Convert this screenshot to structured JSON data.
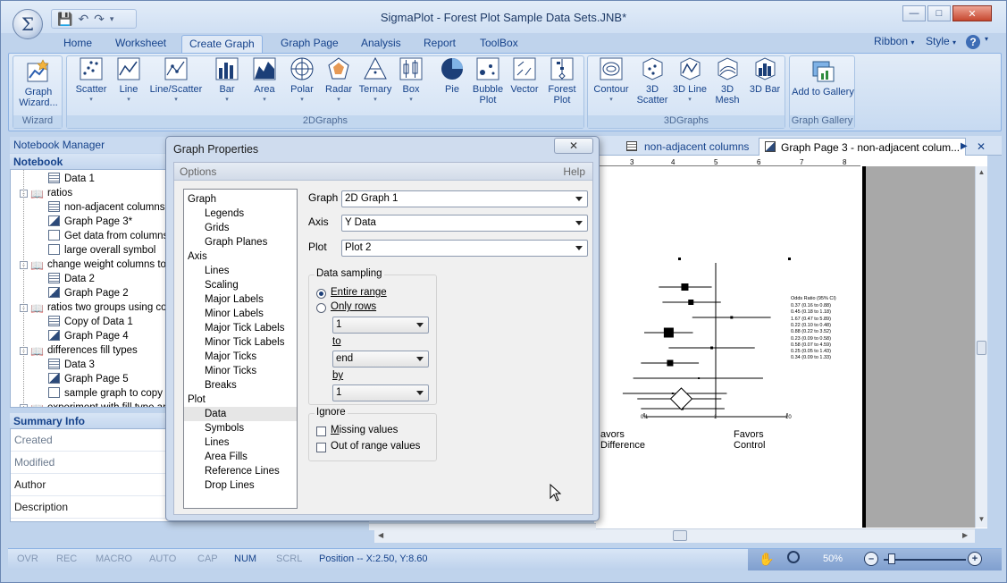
{
  "window": {
    "title": "SigmaPlot - Forest Plot Sample Data Sets.JNB*"
  },
  "quick_access": {
    "icons": [
      "save-icon",
      "undo-icon",
      "redo-icon",
      "customize-icon"
    ]
  },
  "ribbon_tabs": [
    "Home",
    "Worksheet",
    "Create Graph",
    "Graph Page",
    "Analysis",
    "Report",
    "ToolBox"
  ],
  "ribbon_active": "Create Graph",
  "ribbon_right": {
    "ribbon": "Ribbon",
    "style": "Style"
  },
  "groups": {
    "wizard": {
      "label": "Wizard",
      "buttons": [
        {
          "label": "Graph Wizard...",
          "icon": "graph-wizard-icon"
        }
      ]
    },
    "graphs2d": {
      "label": "2DGraphs",
      "buttons": [
        {
          "label": "Scatter",
          "icon": "scatter-icon"
        },
        {
          "label": "Line",
          "icon": "line-icon"
        },
        {
          "label": "Line/Scatter",
          "icon": "line-scatter-icon"
        },
        {
          "label": "Bar",
          "icon": "bar-icon"
        },
        {
          "label": "Area",
          "icon": "area-icon"
        },
        {
          "label": "Polar",
          "icon": "polar-icon"
        },
        {
          "label": "Radar",
          "icon": "radar-icon"
        },
        {
          "label": "Ternary",
          "icon": "ternary-icon"
        },
        {
          "label": "Box",
          "icon": "box-icon"
        },
        {
          "label": "Pie",
          "icon": "pie-icon"
        },
        {
          "label": "Bubble Plot",
          "icon": "bubble-icon"
        },
        {
          "label": "Vector",
          "icon": "vector-icon"
        },
        {
          "label": "Forest Plot",
          "icon": "forest-icon"
        }
      ]
    },
    "graphs3d": {
      "label": "3DGraphs",
      "buttons": [
        {
          "label": "Contour",
          "icon": "contour-icon"
        },
        {
          "label": "3D Scatter",
          "icon": "scatter-3d-icon"
        },
        {
          "label": "3D Line",
          "icon": "line-3d-icon"
        },
        {
          "label": "3D Mesh",
          "icon": "mesh-3d-icon"
        },
        {
          "label": "3D Bar",
          "icon": "bar-3d-icon"
        }
      ]
    },
    "gallery": {
      "label": "Graph Gallery",
      "buttons": [
        {
          "label": "Add to Gallery",
          "icon": "gallery-icon"
        }
      ]
    }
  },
  "notebook_manager": {
    "title": "Notebook Manager",
    "section": "Notebook"
  },
  "tree": [
    {
      "label": "Data 1",
      "icon": "sheet",
      "indent": 2
    },
    {
      "label": "ratios",
      "icon": "folder",
      "indent": 1,
      "exp": "-"
    },
    {
      "label": "non-adjacent columns",
      "icon": "sheet",
      "indent": 2
    },
    {
      "label": "Graph Page 3*",
      "icon": "graph",
      "indent": 2
    },
    {
      "label": "Get data from columns",
      "icon": "doc",
      "indent": 2
    },
    {
      "label": "large overall symbol",
      "icon": "doc",
      "indent": 2
    },
    {
      "label": "change weight columns to c",
      "icon": "folder",
      "indent": 1,
      "exp": "-"
    },
    {
      "label": "Data 2",
      "icon": "sheet",
      "indent": 2
    },
    {
      "label": "Graph Page 2",
      "icon": "graph",
      "indent": 2
    },
    {
      "label": "ratios two groups using colu",
      "icon": "folder",
      "indent": 1,
      "exp": "-"
    },
    {
      "label": "Copy of Data 1",
      "icon": "sheet",
      "indent": 2
    },
    {
      "label": "Graph Page 4",
      "icon": "graph",
      "indent": 2
    },
    {
      "label": "differences fill types",
      "icon": "folder",
      "indent": 1,
      "exp": "-"
    },
    {
      "label": "Data 3",
      "icon": "sheet",
      "indent": 2
    },
    {
      "label": "Graph Page 5",
      "icon": "graph",
      "indent": 2
    },
    {
      "label": "sample graph to copy",
      "icon": "doc",
      "indent": 2
    },
    {
      "label": "experiment with fill type and",
      "icon": "folder",
      "indent": 1,
      "exp": "+"
    }
  ],
  "summary": {
    "title": "Summary Info",
    "rows": [
      {
        "label": "Created",
        "dark": false
      },
      {
        "label": "Modified",
        "dark": false
      },
      {
        "label": "Author",
        "dark": true
      },
      {
        "label": "Description",
        "dark": true
      }
    ]
  },
  "doc_tabs": [
    {
      "label": "non-adjacent columns",
      "active": false
    },
    {
      "label": "Graph Page 3 - non-adjacent colum...",
      "active": true
    }
  ],
  "dialog": {
    "title": "Graph Properties",
    "options_label": "Options",
    "help_label": "Help",
    "tree": [
      {
        "label": "Graph",
        "level": 0
      },
      {
        "label": "Legends",
        "level": 1
      },
      {
        "label": "Grids",
        "level": 1
      },
      {
        "label": "Graph Planes",
        "level": 1
      },
      {
        "label": "Axis",
        "level": 0
      },
      {
        "label": "Lines",
        "level": 1
      },
      {
        "label": "Scaling",
        "level": 1
      },
      {
        "label": "Major Labels",
        "level": 1
      },
      {
        "label": "Minor Labels",
        "level": 1
      },
      {
        "label": "Major Tick Labels",
        "level": 1
      },
      {
        "label": "Minor Tick Labels",
        "level": 1
      },
      {
        "label": "Major Ticks",
        "level": 1
      },
      {
        "label": "Minor Ticks",
        "level": 1
      },
      {
        "label": "Breaks",
        "level": 1
      },
      {
        "label": "Plot",
        "level": 0
      },
      {
        "label": "Data",
        "level": 1,
        "selected": true
      },
      {
        "label": "Symbols",
        "level": 1
      },
      {
        "label": "Lines",
        "level": 1
      },
      {
        "label": "Area Fills",
        "level": 1
      },
      {
        "label": "Reference Lines",
        "level": 1
      },
      {
        "label": "Drop Lines",
        "level": 1
      }
    ],
    "graph_label": "Graph",
    "graph_value": "2D Graph 1",
    "axis_label": "Axis",
    "axis_value": "Y Data",
    "plot_label": "Plot",
    "plot_value": "Plot 2",
    "sampling_title": "Data sampling",
    "entire_range": "Entire range",
    "only_rows": "Only rows",
    "from_value": "1",
    "to_label": "to",
    "to_value": "end",
    "by_label": "by",
    "by_value": "1",
    "ignore_title": "Ignore",
    "missing_values": "Missing values",
    "out_of_range": "Out of range values"
  },
  "forest": {
    "header": "Odds Ratio (95% CI)",
    "rows": [
      "0.37 (0.16 to 0.88)",
      "0.45 (0.18 to 1.18)",
      "1.67 (0.47 to 5.89)",
      "0.22 (0.10 to 0.48)",
      "0.88 (0.22 to 3.52)",
      "0.23 (0.09 to 0.58)",
      "0.58 (0.07 to 4.59)",
      "0.25 (0.05 to 1.43)",
      "0.34 (0.09 to 1.33)"
    ],
    "x_ticks": [
      "0.1",
      "1",
      "10"
    ],
    "favors_left": "avors",
    "favors_left2": "Difference",
    "favors_right": "Favors",
    "favors_right2": "Control",
    "ruler_marks": [
      "3",
      "4",
      "5",
      "6",
      "7",
      "8"
    ]
  },
  "status": {
    "items": [
      {
        "label": "OVR",
        "on": false
      },
      {
        "label": "REC",
        "on": false
      },
      {
        "label": "MACRO",
        "on": false
      },
      {
        "label": "AUTO",
        "on": false
      },
      {
        "label": "CAP",
        "on": false
      },
      {
        "label": "NUM",
        "on": true
      },
      {
        "label": "SCRL",
        "on": false
      }
    ],
    "position": "Position -- X:2.50, Y:8.60",
    "zoom": "50%"
  }
}
